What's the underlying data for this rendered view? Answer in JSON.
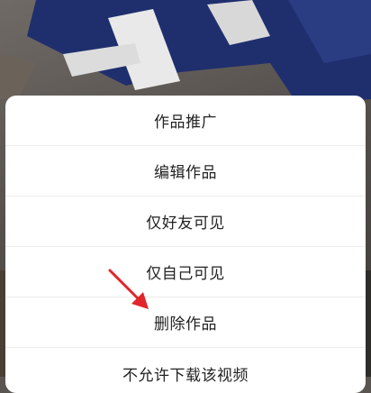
{
  "menu": {
    "items": [
      {
        "label": "作品推广"
      },
      {
        "label": "编辑作品"
      },
      {
        "label": "仅好友可见"
      },
      {
        "label": "仅自己可见"
      },
      {
        "label": "删除作品"
      },
      {
        "label": "不允许下载该视频"
      }
    ]
  },
  "colors": {
    "sheet_bg": "#ffffff",
    "text": "#222222",
    "divider": "#ececec",
    "arrow": "#e0262b",
    "background_blue": "#1f2f6e"
  }
}
